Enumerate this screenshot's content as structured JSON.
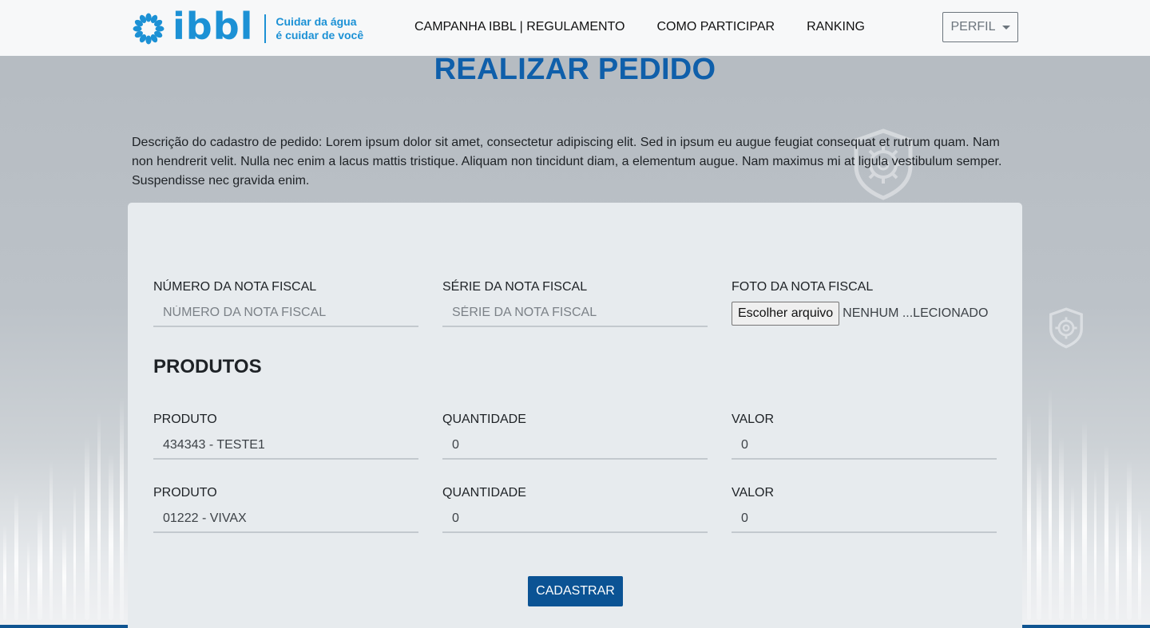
{
  "header": {
    "logo": {
      "word": "ibbl",
      "tagline_line1": "Cuidar da água",
      "tagline_line2": "é cuidar de você",
      "icon": "flower-burst-logo-icon"
    },
    "nav": [
      {
        "label": "CAMPANHA IBBL | REGULAMENTO"
      },
      {
        "label": "COMO PARTICIPAR"
      },
      {
        "label": "RANKING"
      }
    ],
    "profile": {
      "label": "PERFIL",
      "icon": "caret-down-icon"
    }
  },
  "page": {
    "title": "REALIZAR PEDIDO",
    "description": "Descrição do cadastro de pedido: Lorem ipsum dolor sit amet, consectetur adipiscing elit. Sed in ipsum eu augue feugiat consequat et rutrum quam. Nam non hendrerit velit. Nulla nec enim a lacus mattis tristique. Aliquam non tincidunt diam, a elementum augue. Nam maximus mi at ligula vestibulum semper. Suspendisse nec gravida enim."
  },
  "form": {
    "invoice_number": {
      "label": "NÚMERO DA NOTA FISCAL",
      "placeholder": "NÚMERO DA NOTA FISCAL",
      "value": ""
    },
    "invoice_series": {
      "label": "SÉRIE DA NOTA FISCAL",
      "placeholder": "SÉRIE DA NOTA FISCAL",
      "value": ""
    },
    "invoice_photo": {
      "label": "FOTO DA NOTA FISCAL",
      "button_label": "Escolher arquivo",
      "file_name": "NENHUM ...LECIONADO"
    },
    "products_title": "PRODUTOS",
    "products": [
      {
        "product": {
          "label": "PRODUTO",
          "value": "434343 - TESTE1"
        },
        "quantity": {
          "label": "QUANTIDADE",
          "value": "0"
        },
        "price": {
          "label": "VALOR",
          "value": "0"
        }
      },
      {
        "product": {
          "label": "PRODUTO",
          "value": "01222 - VIVAX"
        },
        "quantity": {
          "label": "QUANTIDADE",
          "value": "0"
        },
        "price": {
          "label": "VALOR",
          "value": "0"
        }
      }
    ],
    "submit_label": "CADASTRAR"
  },
  "colors": {
    "brand_blue": "#1c91d5",
    "title_blue": "#0f5faa",
    "button_blue": "#0b5394",
    "header_bg": "#f7f8f9",
    "card_bg": "#e7ebee"
  }
}
